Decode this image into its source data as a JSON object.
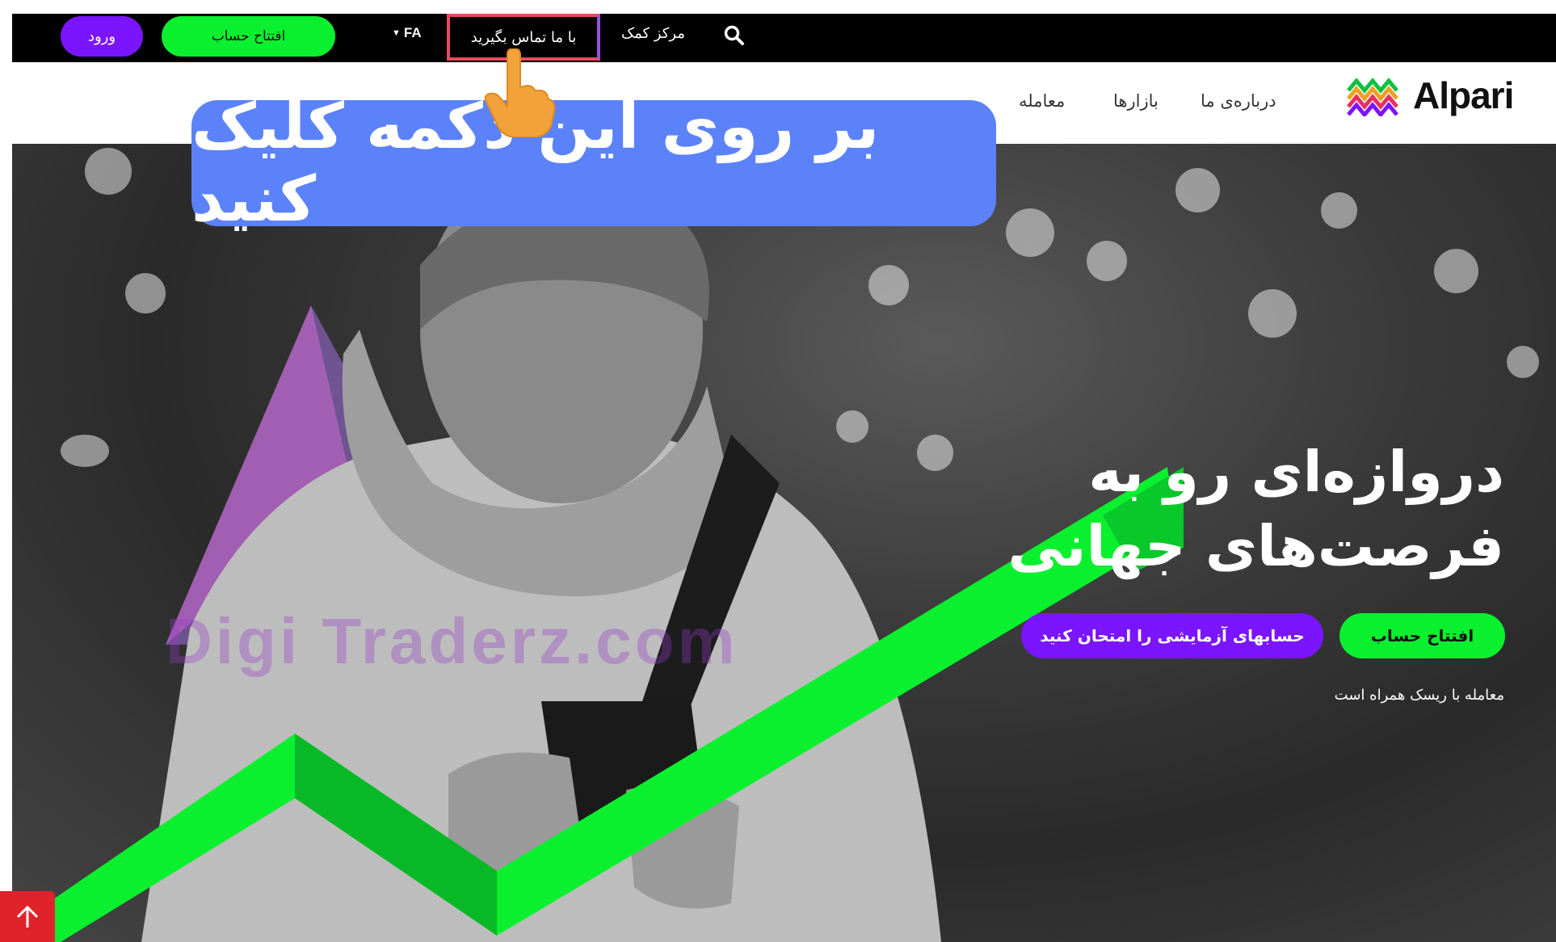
{
  "topbar": {
    "login_label": "ورود",
    "open_account_label": "افتتاح حساب",
    "language": "FA",
    "contact_label": "با ما تماس بگیرید",
    "help_label": "مرکز کمک",
    "search_icon": "search-icon"
  },
  "nav": {
    "logo_text": "Alpari",
    "items": [
      {
        "label": "درباره‌ی ما"
      },
      {
        "label": "بازارها"
      },
      {
        "label": "معامله"
      }
    ]
  },
  "hero": {
    "title_line1": "دروازه‌ای رو به",
    "title_line2": "فرصت‌های جهانی",
    "open_account_label": "افتتاح حساب",
    "demo_label": "حسابهای آزمایشی را امتحان کنید",
    "risk_note": "معامله با ریسک همراه است",
    "watermark": "Digi Traderz.com"
  },
  "tutorial": {
    "caption": "بر روی این دکمه کلیک کنید",
    "pointer_icon": "hand-pointer-icon"
  },
  "colors": {
    "accent_green": "#0af02e",
    "accent_purple": "#7b15ff",
    "highlight_red": "#e8495f",
    "caption_blue": "#5b82f9"
  }
}
